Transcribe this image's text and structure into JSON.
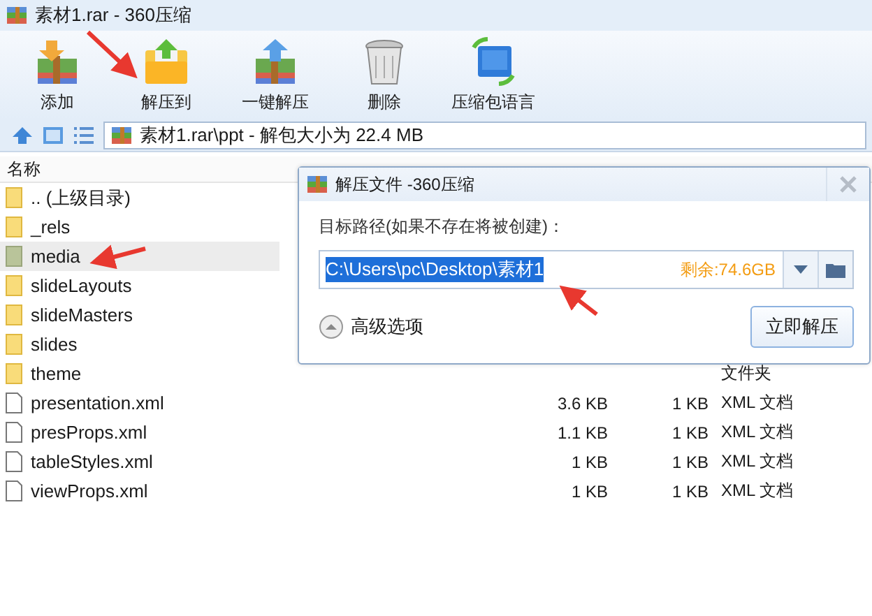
{
  "window": {
    "title": "素材1.rar - 360压缩"
  },
  "toolbar": [
    {
      "label": "添加",
      "kind": "add"
    },
    {
      "label": "解压到",
      "kind": "extract_to"
    },
    {
      "label": "一键解压",
      "kind": "one_click"
    },
    {
      "label": "删除",
      "kind": "delete"
    },
    {
      "label": "压缩包语言",
      "kind": "language"
    }
  ],
  "address": {
    "path": "素材1.rar\\ppt - 解包大小为 22.4 MB"
  },
  "table": {
    "columns": [
      "名称"
    ],
    "rows": [
      {
        "name": ".. (上级目录)",
        "kind": "folder",
        "hovered": false
      },
      {
        "name": "_rels",
        "kind": "folder",
        "hovered": false
      },
      {
        "name": "media",
        "kind": "media_folder",
        "hovered": true
      },
      {
        "name": "slideLayouts",
        "kind": "folder",
        "hovered": false
      },
      {
        "name": "slideMasters",
        "kind": "folder",
        "hovered": false
      },
      {
        "name": "slides",
        "kind": "folder",
        "hovered": false
      },
      {
        "name": "theme",
        "kind": "folder",
        "hovered": false,
        "type": "文件夹"
      },
      {
        "name": "presentation.xml",
        "kind": "file",
        "hovered": false,
        "size": "3.6 KB",
        "packed": "1 KB",
        "type": "XML 文档"
      },
      {
        "name": "presProps.xml",
        "kind": "file",
        "hovered": false,
        "size": "1.1 KB",
        "packed": "1 KB",
        "type": "XML 文档"
      },
      {
        "name": "tableStyles.xml",
        "kind": "file",
        "hovered": false,
        "size": "1 KB",
        "packed": "1 KB",
        "type": "XML 文档"
      },
      {
        "name": "viewProps.xml",
        "kind": "file",
        "hovered": false,
        "size": "1 KB",
        "packed": "1 KB",
        "type": "XML 文档"
      }
    ]
  },
  "dialog": {
    "title": "解压文件 -360压缩",
    "path_label": "目标路径(如果不存在将被创建)：",
    "path": "C:\\Users\\pc\\Desktop\\素材1",
    "path_selected": true,
    "free_space": "剩余:74.6GB",
    "advanced": "高级选项",
    "extract_button": "立即解压"
  }
}
